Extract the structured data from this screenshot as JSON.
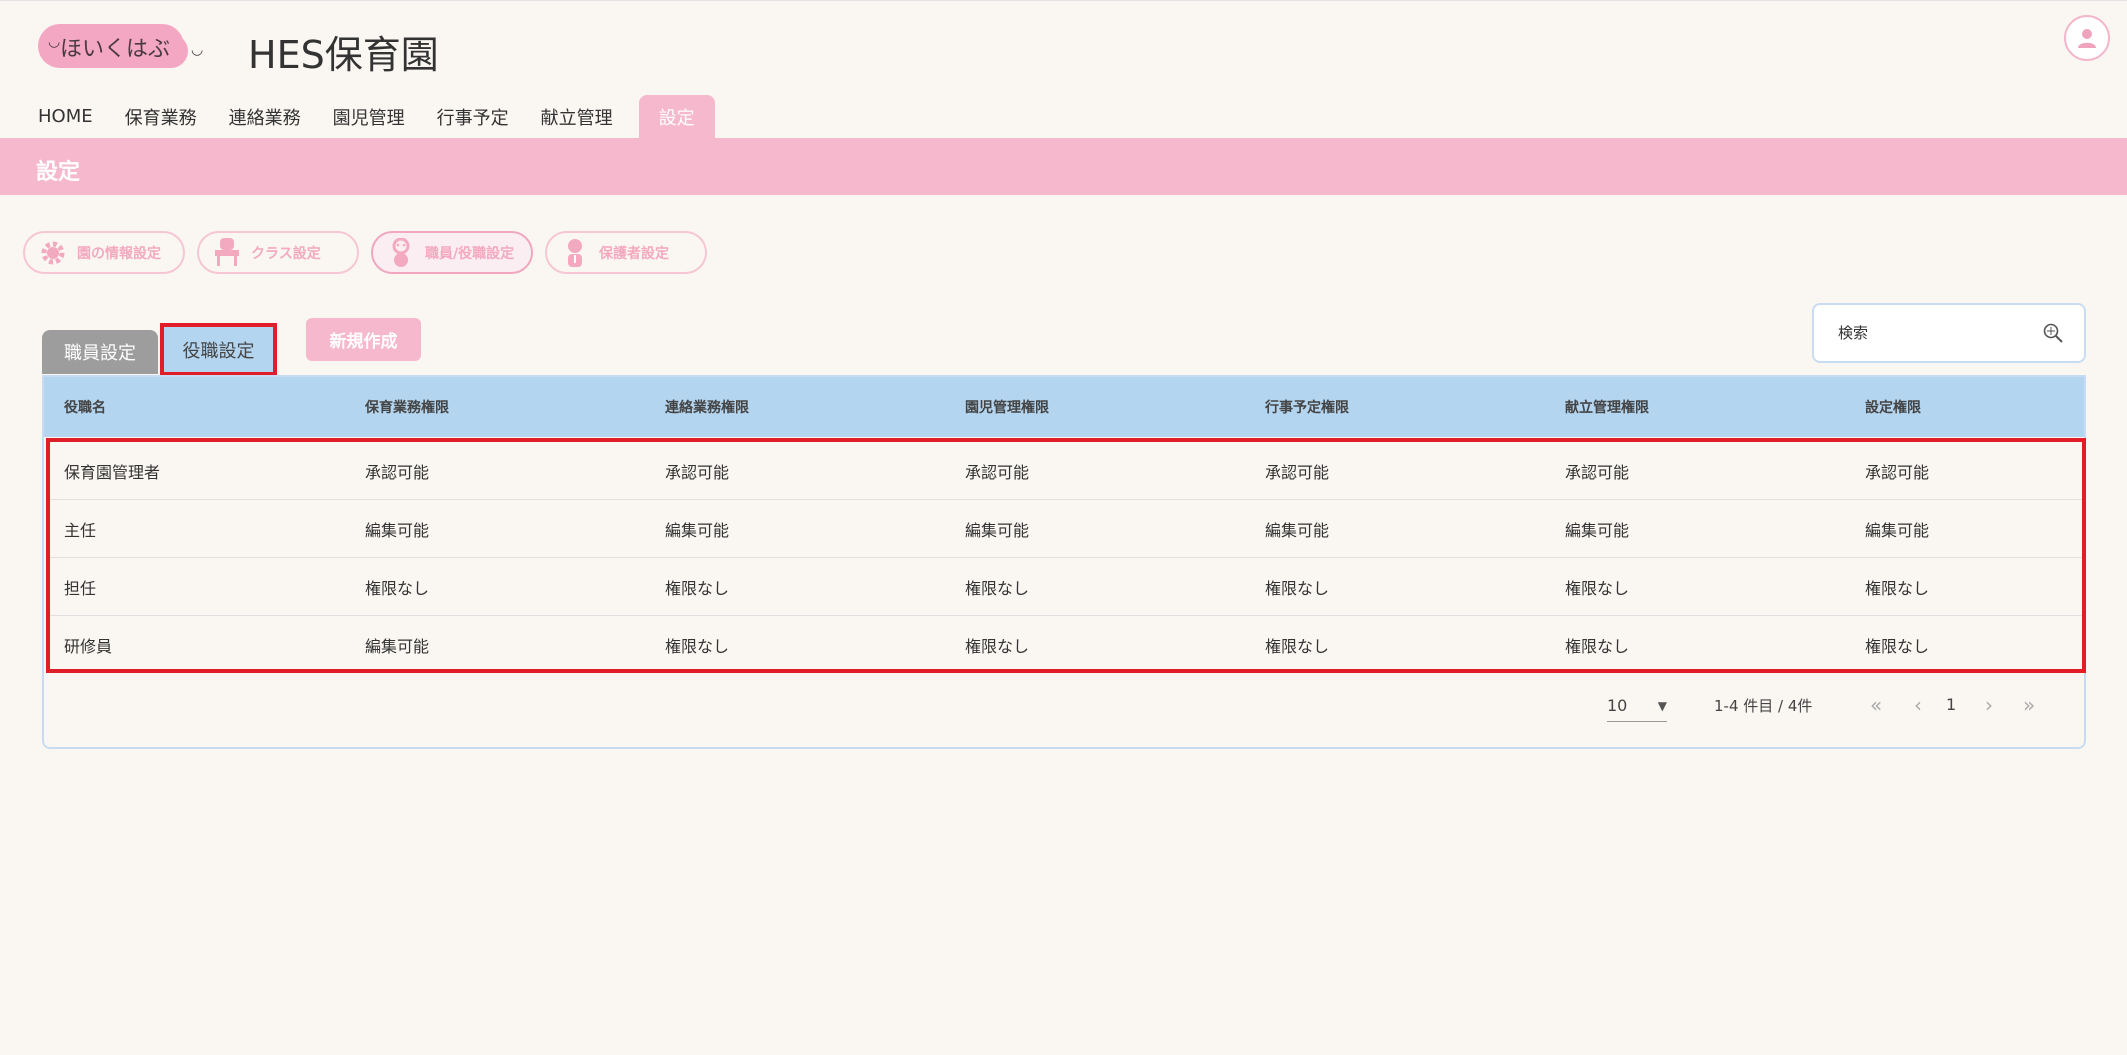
{
  "header": {
    "logo_text": "ほいくはぶ",
    "site_title": "HES保育園"
  },
  "nav": {
    "items": [
      {
        "label": "HOME"
      },
      {
        "label": "保育業務"
      },
      {
        "label": "連絡業務"
      },
      {
        "label": "園児管理"
      },
      {
        "label": "行事予定"
      },
      {
        "label": "献立管理"
      },
      {
        "label": "設定"
      }
    ],
    "active": "設定"
  },
  "page": {
    "title": "設定"
  },
  "settings_pills": [
    {
      "label": "園の情報設定",
      "icon": "gear-icon"
    },
    {
      "label": "クラス設定",
      "icon": "desk-icon"
    },
    {
      "label": "職員/役職設定",
      "icon": "staff-icon"
    },
    {
      "label": "保護者設定",
      "icon": "guardian-icon"
    }
  ],
  "tabs": {
    "staff": "職員設定",
    "role": "役職設定"
  },
  "new_button": "新規作成",
  "search": {
    "placeholder": "検索"
  },
  "table": {
    "headers": [
      "役職名",
      "保育業務権限",
      "連絡業務権限",
      "園児管理権限",
      "行事予定権限",
      "献立管理権限",
      "設定権限"
    ],
    "rows": [
      [
        "保育園管理者",
        "承認可能",
        "承認可能",
        "承認可能",
        "承認可能",
        "承認可能",
        "承認可能"
      ],
      [
        "主任",
        "編集可能",
        "編集可能",
        "編集可能",
        "編集可能",
        "編集可能",
        "編集可能"
      ],
      [
        "担任",
        "権限なし",
        "権限なし",
        "権限なし",
        "権限なし",
        "権限なし",
        "権限なし"
      ],
      [
        "研修員",
        "編集可能",
        "権限なし",
        "権限なし",
        "権限なし",
        "権限なし",
        "権限なし"
      ]
    ]
  },
  "pagination": {
    "per_page": "10",
    "info": "1-4 件目 / 4件",
    "current_page": "1"
  },
  "colors": {
    "pink": "#f5b8cd",
    "blue_header": "#b4d5f0",
    "highlight_red": "#e11d2a",
    "background": "#faf7f3"
  }
}
